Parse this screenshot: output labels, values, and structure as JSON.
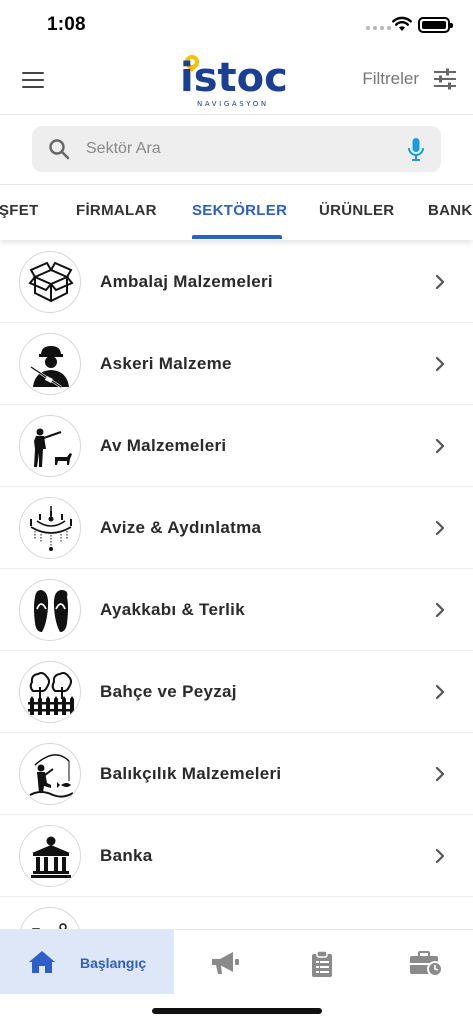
{
  "status_bar": {
    "time": "1:08",
    "icons": [
      "signal-dots-icon",
      "wifi-icon",
      "battery-icon"
    ]
  },
  "header": {
    "menu_icon": "hamburger-menu-icon",
    "logo_text": "istoc",
    "logo_subtext": "NAVIGASYON",
    "filters_label": "Filtreler",
    "filters_icon": "sliders-icon"
  },
  "search": {
    "placeholder": "Sektör Ara",
    "value": "",
    "icon": "search-icon",
    "mic_icon": "microphone-icon"
  },
  "tabs": {
    "items": [
      {
        "label": "ŞFET",
        "active": false
      },
      {
        "label": "FİRMALAR",
        "active": false
      },
      {
        "label": "SEKTÖRLER",
        "active": true
      },
      {
        "label": "ÜRÜNLER",
        "active": false
      },
      {
        "label": "BANKA",
        "active": false
      }
    ]
  },
  "sectors": [
    {
      "label": "Ambalaj Malzemeleri",
      "icon": "box-icon"
    },
    {
      "label": "Askeri Malzeme",
      "icon": "soldier-icon"
    },
    {
      "label": "Av Malzemeleri",
      "icon": "hunter-icon"
    },
    {
      "label": "Avize & Aydınlatma",
      "icon": "chandelier-icon"
    },
    {
      "label": "Ayakkabı & Terlik",
      "icon": "flip-flops-icon"
    },
    {
      "label": "Bahçe ve Peyzaj",
      "icon": "garden-icon"
    },
    {
      "label": "Balıkçılık Malzemeleri",
      "icon": "fishing-icon"
    },
    {
      "label": "Banka",
      "icon": "bank-icon"
    }
  ],
  "bottom_nav": {
    "home_label": "Başlangıç",
    "items": [
      "home-icon",
      "megaphone-icon",
      "clipboard-icon",
      "briefcase-clock-icon"
    ]
  },
  "colors": {
    "accent": "#2e5fc9",
    "logo": "#1b3f93",
    "logo_pin": "#f5c000",
    "mic": "#1a9be0",
    "home_tab_bg": "#dde7f7"
  }
}
